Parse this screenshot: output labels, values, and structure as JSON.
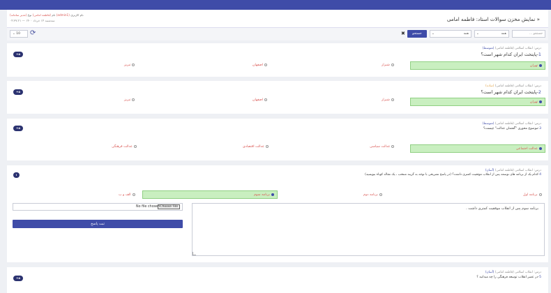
{
  "header": {
    "title": "« نمایش مخزن سوالات استاد: فاطمه امامی",
    "meta_date_label": "نام کاربری",
    "meta_user": "(admin1)",
    "meta_name_label": "نام",
    "meta_name": "(فاطمه امامی)",
    "meta_type_label": "نوع",
    "meta_type": "(مدیر سامانه)",
    "meta_line2": "سه‌شنبه ۱۴ خرداد ۱۴۰۰ — ۰۴:۳۷:۲۱"
  },
  "toolbar": {
    "search_placeholder": "جستجو ...",
    "filter1": "همه",
    "filter2": "همه",
    "search_label": "جستجو",
    "per_page": "10"
  },
  "questions": [
    {
      "info": "درس: انقلاب اسلامی (فاطمه امامی)",
      "level": "(متوسط)",
      "number": "1",
      "text": "-پایتخت ایران کدام شهر است؟",
      "badge": "+۵",
      "options": [
        "تهران",
        "شیراز",
        "اصفهان",
        "تبریز"
      ]
    },
    {
      "info": "درس: انقلاب اسلامی (فاطمه امامی)",
      "level": "(ساده)",
      "number": "2",
      "text": "-پایتخت ایران کدام شهر است؟",
      "badge": "+۵",
      "options": [
        "تهران",
        "شیراز",
        "اصفهان",
        "تبریز"
      ]
    },
    {
      "info": "درس: انقلاب اسلامی (فاطمه امامی)",
      "level": "(متوسط)",
      "number": "3",
      "text": "-موضوع محوری \"گفتمان عدالت\" چیست؟",
      "badge": "+۵",
      "options": [
        "عدالت اجتماعی",
        "عدالت سیاسی",
        "عدالت اقتصادی",
        "عدالت فرهنگی"
      ]
    },
    {
      "info": "درس: انقلاب اسلامی (فاطمه امامی)",
      "level": "(آسان)",
      "number": "4",
      "text": "-کدام یک از برنامه های توسعه پس از انقلاب موفقیت کمتری داشت؟ (در پاسخ تشریحی با توجه به گزینه منتخب ، یک مقاله کوتاه بنویسید)",
      "badge": "۱",
      "options": [
        "برنامه اول",
        "برنامه دوم",
        "برنامه سوم",
        "الف و ب"
      ],
      "answer_text": "برنامه سوم پس از انقلاب موفقیت کمتری داشت .",
      "no_file": "No file chosen",
      "choose_file": "Choose File",
      "submit": "ثبت پاسخ"
    },
    {
      "info": "درس: انقلاب اسلامی (فاطمه امامی)",
      "level": "(آسان)",
      "number": "5",
      "text": "-در عصر انقلاب توسعه فرهنگی را چه میدانید ؟",
      "badge": "+۵"
    }
  ]
}
